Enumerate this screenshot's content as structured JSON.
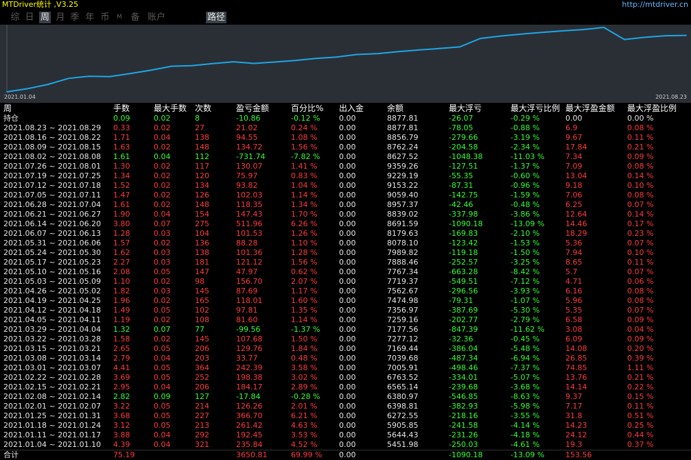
{
  "app": {
    "title": "MTDriver统计 ,V3.25",
    "url": "http://mtdriver.cn"
  },
  "tabs": [
    {
      "label": "综",
      "active": false
    },
    {
      "label": "日",
      "active": false
    },
    {
      "label": "周",
      "active": true
    },
    {
      "label": "月",
      "active": false
    },
    {
      "label": "季",
      "active": false
    },
    {
      "label": "年",
      "active": false
    },
    {
      "label": "币",
      "active": false
    },
    {
      "label": "M",
      "active": false
    },
    {
      "label": "备",
      "active": false
    },
    {
      "label": "账户",
      "active": false
    },
    {
      "label": "路径",
      "active": true
    }
  ],
  "colors": {
    "accent_line": "#1ea7e8",
    "chart_bg": "#2a2f36",
    "positive": "#ff3b3b",
    "negative": "#33ff33",
    "title": "#ffff00",
    "url": "#5fb8ff"
  },
  "chart_data": {
    "type": "line",
    "x_start_label": "2021.01.04",
    "x_end_label": "2021.08.23",
    "x": [
      "2021.01.04",
      "2021.01.11",
      "2021.01.18",
      "2021.01.25",
      "2021.02.01",
      "2021.02.08",
      "2021.02.15",
      "2021.02.22",
      "2021.03.01",
      "2021.03.08",
      "2021.03.15",
      "2021.03.22",
      "2021.03.29",
      "2021.04.05",
      "2021.04.12",
      "2021.04.19",
      "2021.04.26",
      "2021.05.03",
      "2021.05.10",
      "2021.05.17",
      "2021.05.24",
      "2021.05.31",
      "2021.06.07",
      "2021.06.14",
      "2021.06.21",
      "2021.06.28",
      "2021.07.05",
      "2021.07.12",
      "2021.07.19",
      "2021.07.26",
      "2021.08.02",
      "2021.08.09",
      "2021.08.16",
      "2021.08.23"
    ],
    "values": [
      5451.98,
      5644.43,
      5905.85,
      6272.55,
      6398.81,
      6380.97,
      6565.14,
      6763.52,
      7005.91,
      7039.68,
      7169.44,
      7277.12,
      7177.56,
      7259.16,
      7356.97,
      7474.98,
      7562.67,
      7719.37,
      7767.34,
      7888.46,
      7989.82,
      8078.1,
      8179.63,
      8691.59,
      8839.02,
      8957.37,
      9059.4,
      9153.22,
      9229.19,
      9359.26,
      8627.52,
      8762.24,
      8856.79,
      8877.81
    ],
    "series_name": ""
  },
  "table": {
    "headers": [
      "周",
      "手数",
      "最大手数",
      "次数",
      "盈亏金额",
      "百分比%",
      "出入金",
      "余额",
      "最大浮亏",
      "最大浮亏比例",
      "最大浮盈金额",
      "最大浮盈比例"
    ],
    "holding": {
      "label": "持仓",
      "lots": "0.09",
      "max_lots": "0.02",
      "count": "8",
      "pnl": "-10.86",
      "pct": "-0.12 %",
      "io": "0.00",
      "balance": "8877.81",
      "max_float_loss": "-26.07",
      "max_float_loss_pct": "-0.29 %",
      "max_float_profit": "0.00",
      "max_float_profit_pct": "0.00 %"
    },
    "rows": [
      {
        "period": "2021.08.23 ~ 2021.08.29",
        "lots": "0.33",
        "max_lots": "0.02",
        "count": "27",
        "pnl": "21.02",
        "pct": "0.24 %",
        "io": "0.00",
        "balance": "8877.81",
        "mfl": "-78.05",
        "mflp": "-0.88 %",
        "mfp": "6.9",
        "mfpp": "0.08 %",
        "sign": "pos"
      },
      {
        "period": "2021.08.16 ~ 2021.08.22",
        "lots": "1.71",
        "max_lots": "0.04",
        "count": "138",
        "pnl": "94.55",
        "pct": "1.08 %",
        "io": "0.00",
        "balance": "8856.79",
        "mfl": "-279.66",
        "mflp": "-3.19 %",
        "mfp": "9.67",
        "mfpp": "0.11 %",
        "sign": "pos"
      },
      {
        "period": "2021.08.09 ~ 2021.08.15",
        "lots": "1.63",
        "max_lots": "0.02",
        "count": "148",
        "pnl": "134.72",
        "pct": "1.56 %",
        "io": "0.00",
        "balance": "8762.24",
        "mfl": "-204.58",
        "mflp": "-2.34 %",
        "mfp": "17.84",
        "mfpp": "0.21 %",
        "sign": "pos"
      },
      {
        "period": "2021.08.02 ~ 2021.08.08",
        "lots": "1.61",
        "max_lots": "0.04",
        "count": "112",
        "pnl": "-731.74",
        "pct": "-7.82 %",
        "io": "0.00",
        "balance": "8627.52",
        "mfl": "-1048.38",
        "mflp": "-11.03 %",
        "mfp": "7.34",
        "mfpp": "0.09 %",
        "sign": "neg"
      },
      {
        "period": "2021.07.26 ~ 2021.08.01",
        "lots": "1.30",
        "max_lots": "0.02",
        "count": "117",
        "pnl": "130.07",
        "pct": "1.41 %",
        "io": "0.00",
        "balance": "9359.26",
        "mfl": "-127.51",
        "mflp": "-1.37 %",
        "mfp": "7.09",
        "mfpp": "0.08 %",
        "sign": "pos"
      },
      {
        "period": "2021.07.19 ~ 2021.07.25",
        "lots": "1.34",
        "max_lots": "0.02",
        "count": "120",
        "pnl": "75.97",
        "pct": "0.83 %",
        "io": "0.00",
        "balance": "9229.19",
        "mfl": "-55.35",
        "mflp": "-0.60 %",
        "mfp": "13.04",
        "mfpp": "0.14 %",
        "sign": "pos"
      },
      {
        "period": "2021.07.12 ~ 2021.07.18",
        "lots": "1.52",
        "max_lots": "0.02",
        "count": "134",
        "pnl": "93.82",
        "pct": "1.04 %",
        "io": "0.00",
        "balance": "9153.22",
        "mfl": "-87.31",
        "mflp": "-0.96 %",
        "mfp": "9.18",
        "mfpp": "0.10 %",
        "sign": "pos"
      },
      {
        "period": "2021.07.05 ~ 2021.07.11",
        "lots": "1.47",
        "max_lots": "0.02",
        "count": "126",
        "pnl": "102.03",
        "pct": "1.14 %",
        "io": "0.00",
        "balance": "9059.40",
        "mfl": "-142.75",
        "mflp": "-1.59 %",
        "mfp": "7.06",
        "mfpp": "0.08 %",
        "sign": "pos"
      },
      {
        "period": "2021.06.28 ~ 2021.07.04",
        "lots": "1.61",
        "max_lots": "0.02",
        "count": "148",
        "pnl": "118.35",
        "pct": "1.34 %",
        "io": "0.00",
        "balance": "8957.37",
        "mfl": "-42.46",
        "mflp": "-0.48 %",
        "mfp": "6.25",
        "mfpp": "0.07 %",
        "sign": "pos"
      },
      {
        "period": "2021.06.21 ~ 2021.06.27",
        "lots": "1.90",
        "max_lots": "0.04",
        "count": "154",
        "pnl": "147.43",
        "pct": "1.70 %",
        "io": "0.00",
        "balance": "8839.02",
        "mfl": "-337.98",
        "mflp": "-3.86 %",
        "mfp": "12.64",
        "mfpp": "0.14 %",
        "sign": "pos"
      },
      {
        "period": "2021.06.14 ~ 2021.06.20",
        "lots": "3.80",
        "max_lots": "0.07",
        "count": "275",
        "pnl": "511.96",
        "pct": "6.26 %",
        "io": "0.00",
        "balance": "8691.59",
        "mfl": "-1090.18",
        "mflp": "-13.09 %",
        "mfp": "14.46",
        "mfpp": "0.17 %",
        "sign": "pos"
      },
      {
        "period": "2021.06.07 ~ 2021.06.13",
        "lots": "1.28",
        "max_lots": "0.03",
        "count": "104",
        "pnl": "101.53",
        "pct": "1.26 %",
        "io": "0.00",
        "balance": "8179.63",
        "mfl": "-169.83",
        "mflp": "-2.10 %",
        "mfp": "18.29",
        "mfpp": "0.23 %",
        "sign": "pos"
      },
      {
        "period": "2021.05.31 ~ 2021.06.06",
        "lots": "1.57",
        "max_lots": "0.02",
        "count": "136",
        "pnl": "88.28",
        "pct": "1.10 %",
        "io": "0.00",
        "balance": "8078.10",
        "mfl": "-123.42",
        "mflp": "-1.53 %",
        "mfp": "5.36",
        "mfpp": "0.07 %",
        "sign": "pos"
      },
      {
        "period": "2021.05.24 ~ 2021.05.30",
        "lots": "1.62",
        "max_lots": "0.03",
        "count": "138",
        "pnl": "101.36",
        "pct": "1.28 %",
        "io": "0.00",
        "balance": "7989.82",
        "mfl": "-119.18",
        "mflp": "-1.50 %",
        "mfp": "7.94",
        "mfpp": "0.10 %",
        "sign": "pos"
      },
      {
        "period": "2021.05.17 ~ 2021.05.23",
        "lots": "2.27",
        "max_lots": "0.03",
        "count": "181",
        "pnl": "121.12",
        "pct": "1.56 %",
        "io": "0.00",
        "balance": "7888.46",
        "mfl": "-252.57",
        "mflp": "-3.25 %",
        "mfp": "8.65",
        "mfpp": "0.11 %",
        "sign": "pos"
      },
      {
        "period": "2021.05.10 ~ 2021.05.16",
        "lots": "2.08",
        "max_lots": "0.05",
        "count": "147",
        "pnl": "47.97",
        "pct": "0.62 %",
        "io": "0.00",
        "balance": "7767.34",
        "mfl": "-663.28",
        "mflp": "-8.42 %",
        "mfp": "5.7",
        "mfpp": "0.07 %",
        "sign": "pos"
      },
      {
        "period": "2021.05.03 ~ 2021.05.09",
        "lots": "1.10",
        "max_lots": "0.02",
        "count": "98",
        "pnl": "156.70",
        "pct": "2.07 %",
        "io": "0.00",
        "balance": "7719.37",
        "mfl": "-549.51",
        "mflp": "-7.12 %",
        "mfp": "4.71",
        "mfpp": "0.06 %",
        "sign": "pos"
      },
      {
        "period": "2021.04.26 ~ 2021.05.02",
        "lots": "1.82",
        "max_lots": "0.03",
        "count": "145",
        "pnl": "87.69",
        "pct": "1.17 %",
        "io": "0.00",
        "balance": "7562.67",
        "mfl": "-296.56",
        "mflp": "-3.93 %",
        "mfp": "6.16",
        "mfpp": "0.08 %",
        "sign": "pos"
      },
      {
        "period": "2021.04.19 ~ 2021.04.25",
        "lots": "1.96",
        "max_lots": "0.02",
        "count": "165",
        "pnl": "118.01",
        "pct": "1.60 %",
        "io": "0.00",
        "balance": "7474.98",
        "mfl": "-79.31",
        "mflp": "-1.07 %",
        "mfp": "5.96",
        "mfpp": "0.08 %",
        "sign": "pos"
      },
      {
        "period": "2021.04.12 ~ 2021.04.18",
        "lots": "1.49",
        "max_lots": "0.05",
        "count": "102",
        "pnl": "97.81",
        "pct": "1.35 %",
        "io": "0.00",
        "balance": "7356.97",
        "mfl": "-387.69",
        "mflp": "-5.30 %",
        "mfp": "5.35",
        "mfpp": "0.07 %",
        "sign": "pos"
      },
      {
        "period": "2021.04.05 ~ 2021.04.11",
        "lots": "1.19",
        "max_lots": "0.02",
        "count": "108",
        "pnl": "81.60",
        "pct": "1.14 %",
        "io": "0.00",
        "balance": "7259.16",
        "mfl": "-202.77",
        "mflp": "-2.79 %",
        "mfp": "6.58",
        "mfpp": "0.09 %",
        "sign": "pos"
      },
      {
        "period": "2021.03.29 ~ 2021.04.04",
        "lots": "1.32",
        "max_lots": "0.07",
        "count": "77",
        "pnl": "-99.56",
        "pct": "-1.37 %",
        "io": "0.00",
        "balance": "7177.56",
        "mfl": "-847.39",
        "mflp": "-11.62 %",
        "mfp": "3.08",
        "mfpp": "0.04 %",
        "sign": "neg"
      },
      {
        "period": "2021.03.22 ~ 2021.03.28",
        "lots": "1.58",
        "max_lots": "0.02",
        "count": "145",
        "pnl": "107.68",
        "pct": "1.50 %",
        "io": "0.00",
        "balance": "7277.12",
        "mfl": "-32.36",
        "mflp": "-0.45 %",
        "mfp": "6.09",
        "mfpp": "0.09 %",
        "sign": "pos"
      },
      {
        "period": "2021.03.15 ~ 2021.03.21",
        "lots": "2.65",
        "max_lots": "0.05",
        "count": "206",
        "pnl": "129.76",
        "pct": "1.84 %",
        "io": "0.00",
        "balance": "7169.44",
        "mfl": "-386.04",
        "mflp": "-5.48 %",
        "mfp": "14.08",
        "mfpp": "0.20 %",
        "sign": "pos"
      },
      {
        "period": "2021.03.08 ~ 2021.03.14",
        "lots": "2.79",
        "max_lots": "0.04",
        "count": "203",
        "pnl": "33.77",
        "pct": "0.48 %",
        "io": "0.00",
        "balance": "7039.68",
        "mfl": "-487.34",
        "mflp": "-6.94 %",
        "mfp": "26.85",
        "mfpp": "0.39 %",
        "sign": "pos"
      },
      {
        "period": "2021.03.01 ~ 2021.03.07",
        "lots": "4.41",
        "max_lots": "0.05",
        "count": "364",
        "pnl": "242.39",
        "pct": "3.58 %",
        "io": "0.00",
        "balance": "7005.91",
        "mfl": "-498.46",
        "mflp": "-7.37 %",
        "mfp": "74.85",
        "mfpp": "1.11 %",
        "sign": "pos"
      },
      {
        "period": "2021.02.22 ~ 2021.02.28",
        "lots": "3.69",
        "max_lots": "0.05",
        "count": "252",
        "pnl": "198.38",
        "pct": "3.02 %",
        "io": "0.00",
        "balance": "6763.52",
        "mfl": "-334.01",
        "mflp": "-5.07 %",
        "mfp": "13.76",
        "mfpp": "0.21 %",
        "sign": "pos"
      },
      {
        "period": "2021.02.15 ~ 2021.02.21",
        "lots": "2.95",
        "max_lots": "0.04",
        "count": "206",
        "pnl": "184.17",
        "pct": "2.89 %",
        "io": "0.00",
        "balance": "6565.14",
        "mfl": "-239.68",
        "mflp": "-3.68 %",
        "mfp": "14.14",
        "mfpp": "0.22 %",
        "sign": "pos"
      },
      {
        "period": "2021.02.08 ~ 2021.02.14",
        "lots": "2.82",
        "max_lots": "0.09",
        "count": "127",
        "pnl": "-17.84",
        "pct": "-0.28 %",
        "io": "0.00",
        "balance": "6380.97",
        "mfl": "-546.85",
        "mflp": "-8.63 %",
        "mfp": "9.37",
        "mfpp": "0.15 %",
        "sign": "neg"
      },
      {
        "period": "2021.02.01 ~ 2021.02.07",
        "lots": "3.22",
        "max_lots": "0.05",
        "count": "214",
        "pnl": "126.26",
        "pct": "2.01 %",
        "io": "0.00",
        "balance": "6398.81",
        "mfl": "-382.93",
        "mflp": "-5.98 %",
        "mfp": "7.17",
        "mfpp": "0.11 %",
        "sign": "pos"
      },
      {
        "period": "2021.01.25 ~ 2021.01.31",
        "lots": "3.68",
        "max_lots": "0.05",
        "count": "227",
        "pnl": "366.70",
        "pct": "6.21 %",
        "io": "0.00",
        "balance": "6272.55",
        "mfl": "-218.16",
        "mflp": "-3.55 %",
        "mfp": "31.8",
        "mfpp": "0.51 %",
        "sign": "pos"
      },
      {
        "period": "2021.01.18 ~ 2021.01.24",
        "lots": "3.12",
        "max_lots": "0.05",
        "count": "213",
        "pnl": "261.42",
        "pct": "4.63 %",
        "io": "0.00",
        "balance": "5905.85",
        "mfl": "-241.58",
        "mflp": "-4.14 %",
        "mfp": "14.23",
        "mfpp": "0.25 %",
        "sign": "pos"
      },
      {
        "period": "2021.01.11 ~ 2021.01.17",
        "lots": "3.88",
        "max_lots": "0.04",
        "count": "292",
        "pnl": "192.45",
        "pct": "3.53 %",
        "io": "0.00",
        "balance": "5644.43",
        "mfl": "-231.26",
        "mflp": "-4.18 %",
        "mfp": "24.12",
        "mfpp": "0.44 %",
        "sign": "pos"
      },
      {
        "period": "2021.01.04 ~ 2021.01.10",
        "lots": "4.39",
        "max_lots": "0.04",
        "count": "321",
        "pnl": "235.84",
        "pct": "4.52 %",
        "io": "0.00",
        "balance": "5451.98",
        "mfl": "-250.03",
        "mflp": "-4.61 %",
        "mfp": "19.3",
        "mfpp": "0.37 %",
        "sign": "pos"
      }
    ],
    "total": {
      "label": "合计",
      "lots": "75.19",
      "max_lots": "",
      "count": "",
      "pnl": "3650.81",
      "pct": "69.99 %",
      "io": "0.00",
      "balance": "",
      "mfl": "-1090.18",
      "mflp": "-13.09 %",
      "mfp": "153.56",
      "mfpp": ""
    }
  }
}
